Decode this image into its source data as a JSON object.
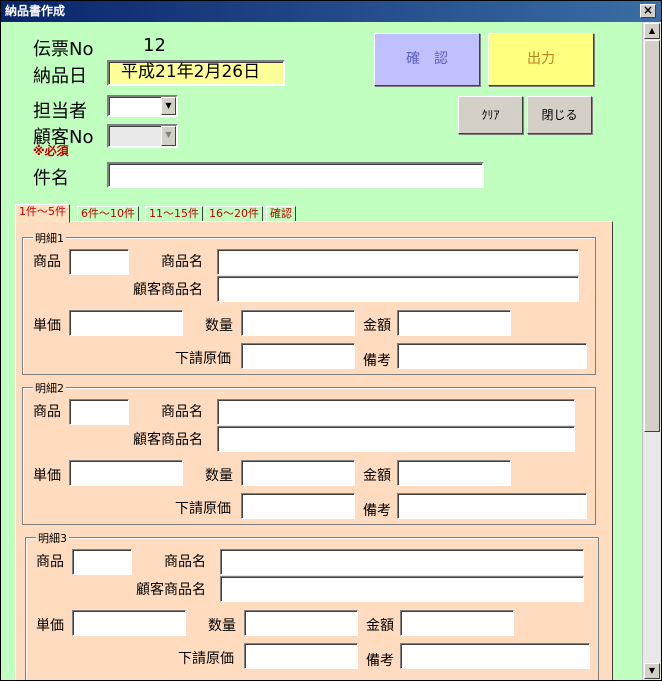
{
  "window": {
    "title": "納品書作成",
    "close_label": "×"
  },
  "header": {
    "slip_label": "伝票No",
    "slip_value": "12",
    "date_label": "納品日",
    "date_value": "平成21年2月26日",
    "staff_label": "担当者",
    "customer_label": "顧客No",
    "required_note": "※必須",
    "subject_label": "件名",
    "subject_value": ""
  },
  "buttons": {
    "confirm": "確　認",
    "output": "出力",
    "clear": "ｸﾘｱ",
    "close": "閉じる"
  },
  "colors": {
    "background": "#c0ffc0",
    "confirm_button": "#c0c0ff",
    "output_button": "#ffff80",
    "panel": "#ffdcc0",
    "tab_text": "#c00000"
  },
  "tabs": [
    {
      "label": "1件～5件",
      "active": true
    },
    {
      "label": "6件～10件",
      "active": false
    },
    {
      "label": "11～15件",
      "active": false
    },
    {
      "label": "16～20件",
      "active": false
    },
    {
      "label": "確認",
      "active": false
    }
  ],
  "detail_labels": {
    "product": "商品",
    "product_name": "商品名",
    "customer_product_name": "顧客商品名",
    "unit_price": "単価",
    "quantity": "数量",
    "amount": "金額",
    "subcontract_cost": "下請原価",
    "remarks": "備考"
  },
  "details": [
    {
      "title": "明細1"
    },
    {
      "title": "明細2"
    },
    {
      "title": "明細3"
    }
  ]
}
